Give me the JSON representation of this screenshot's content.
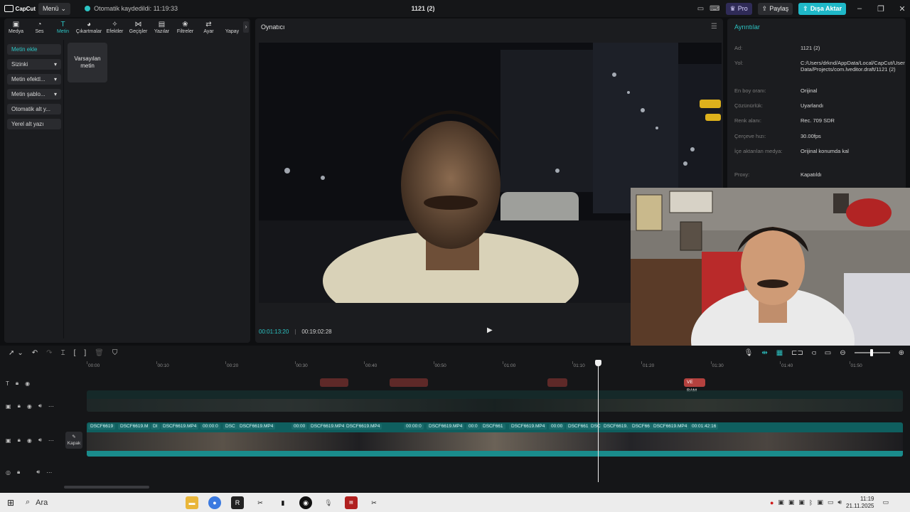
{
  "titlebar": {
    "app_name": "CapCut",
    "menu_label": "Menü",
    "autosave_text": "Otomatik kaydedildi: 11:19:33",
    "project_title": "1121 (2)",
    "pro_label": "Pro",
    "share_label": "Paylaş",
    "export_label": "Dışa Aktar"
  },
  "toolbar": {
    "tools": [
      {
        "label": "Medya",
        "icon": "media-icon"
      },
      {
        "label": "Ses",
        "icon": "audio-icon"
      },
      {
        "label": "Metin",
        "icon": "text-icon"
      },
      {
        "label": "Çıkartmalar",
        "icon": "sticker-icon"
      },
      {
        "label": "Efektler",
        "icon": "effects-icon"
      },
      {
        "label": "Geçişler",
        "icon": "transitions-icon"
      },
      {
        "label": "Yazılar",
        "icon": "captions-icon"
      },
      {
        "label": "Filtreler",
        "icon": "filters-icon"
      },
      {
        "label": "Ayar",
        "icon": "adjust-icon"
      },
      {
        "label": "Yapay",
        "icon": "ai-icon"
      }
    ],
    "active": "Metin"
  },
  "text_categories": {
    "items": [
      {
        "label": "Metin ekle"
      },
      {
        "label": "Sizinki"
      },
      {
        "label": "Metin efektl..."
      },
      {
        "label": "Metin şablo..."
      },
      {
        "label": "Otomatik alt y..."
      },
      {
        "label": "Yerel alt yazı"
      }
    ],
    "default_text_card": "Varsayılan metin"
  },
  "player": {
    "title": "Oynatıcı",
    "current_time": "00:01:13:20",
    "duration": "00:19:02:28"
  },
  "details": {
    "title": "Ayrıntılar",
    "rows": [
      {
        "label": "Ad:",
        "value": "1121 (2)"
      },
      {
        "label": "Yol:",
        "value": "C:/Users/drknd/AppData/Local/CapCut/User Data/Projects/com.lveditor.draft/1121 (2)"
      },
      {
        "label": "En boy oranı:",
        "value": "Orijinal"
      },
      {
        "label": "Çözünürlük:",
        "value": "Uyarlandı"
      },
      {
        "label": "Renk alanı:",
        "value": "Rec. 709 SDR"
      },
      {
        "label": "Çerçeve hızı:",
        "value": "30.00fps"
      },
      {
        "label": "İçe aktarılan medya:",
        "value": "Orijinal konumda kal"
      },
      {
        "label": "Proxy:",
        "value": "Kapatıldı"
      }
    ]
  },
  "timeline": {
    "ruler_ticks": [
      "00:00",
      "00:10",
      "00:20",
      "00:30",
      "00:40",
      "00:50",
      "01:00",
      "01:10",
      "01:20",
      "01:30",
      "01:40",
      "01:50"
    ],
    "text_clips": [
      {
        "label": "VE BAM"
      }
    ],
    "main_clip_labels": [
      "DSCF6619",
      "DSCF6619.M",
      "DI",
      "DSCF6619.MP4",
      "00:00:0",
      "DSC",
      "DSCF6619.MP4",
      "00:00",
      "DSCF6619.MP4",
      "DSCF6619.MP4",
      "00:00:0",
      "DSCF6619.MP4",
      "00:0",
      "DSCF661",
      "DSCF6619.MP4",
      "00:00",
      "DSCF661",
      "DSC",
      "DSCF6619.",
      "DSCF66",
      "DSCF6619.MP4",
      "00:01:42:16"
    ],
    "cover_label": "Kapak"
  },
  "taskbar": {
    "search_placeholder": "Ara",
    "time": "11:19",
    "date": "21.11.2025"
  }
}
